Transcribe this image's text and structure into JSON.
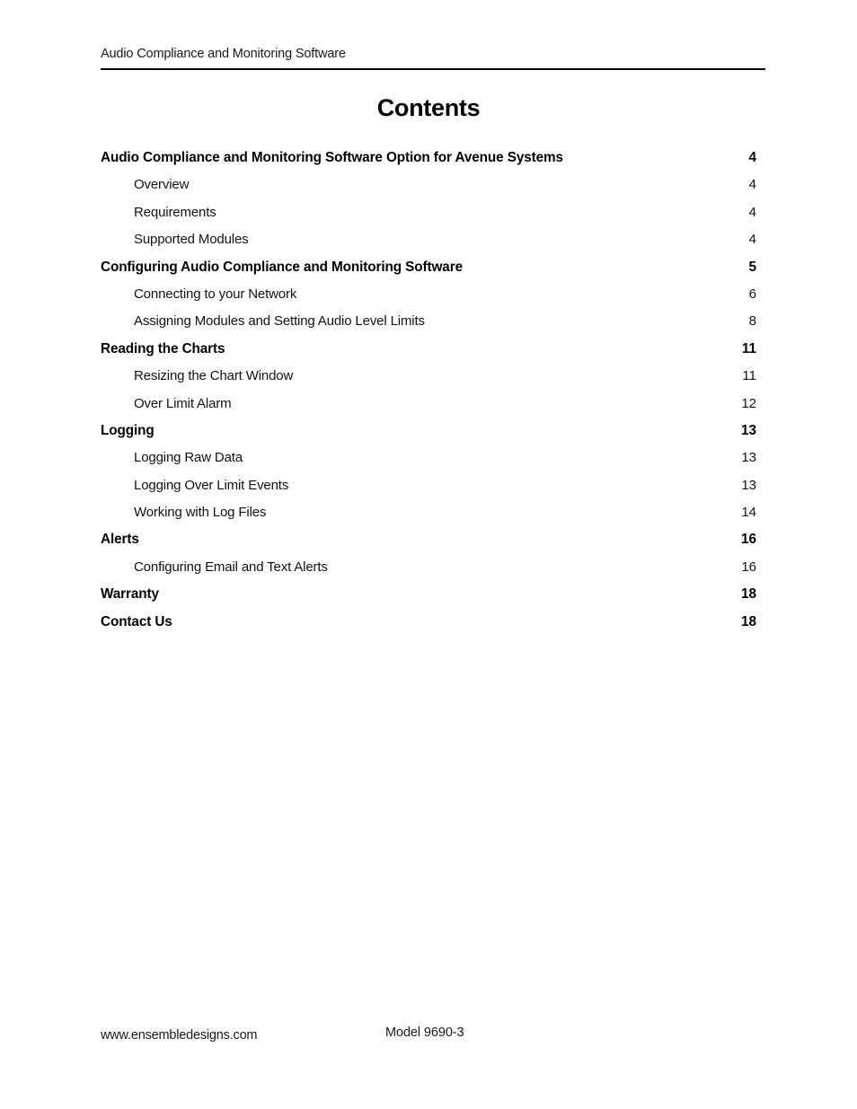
{
  "document": {
    "running_header": "Audio Compliance and Monitoring Software",
    "title": "Contents"
  },
  "toc": {
    "entries": [
      {
        "label": "Audio Compliance and Monitoring Software Option for Avenue Systems",
        "page": "4",
        "level": 1
      },
      {
        "label": "Overview",
        "page": "4",
        "level": 2
      },
      {
        "label": "Requirements",
        "page": "4",
        "level": 2
      },
      {
        "label": "Supported Modules",
        "page": "4",
        "level": 2
      },
      {
        "label": "Configuring Audio Compliance and Monitoring Software",
        "page": "5",
        "level": 1
      },
      {
        "label": "Connecting to your Network",
        "page": "6",
        "level": 2
      },
      {
        "label": "Assigning Modules and Setting Audio Level Limits",
        "page": "8",
        "level": 2
      },
      {
        "label": "Reading the Charts",
        "page": "11",
        "level": 1
      },
      {
        "label": "Resizing the Chart Window",
        "page": "11",
        "level": 2
      },
      {
        "label": "Over Limit Alarm",
        "page": "12",
        "level": 2
      },
      {
        "label": "Logging",
        "page": "13",
        "level": 1
      },
      {
        "label": "Logging Raw Data",
        "page": "13",
        "level": 2
      },
      {
        "label": "Logging Over Limit Events",
        "page": "13",
        "level": 2
      },
      {
        "label": "Working with Log Files",
        "page": "14",
        "level": 2
      },
      {
        "label": "Alerts",
        "page": "16",
        "level": 1
      },
      {
        "label": "Configuring Email and Text Alerts",
        "page": "16",
        "level": 2
      },
      {
        "label": "Warranty",
        "page": "18",
        "level": 1
      },
      {
        "label": "Contact Us",
        "page": "18",
        "level": 1
      }
    ]
  },
  "footer": {
    "url": "www.ensembledesigns.com",
    "model": "Model 9690-3"
  }
}
